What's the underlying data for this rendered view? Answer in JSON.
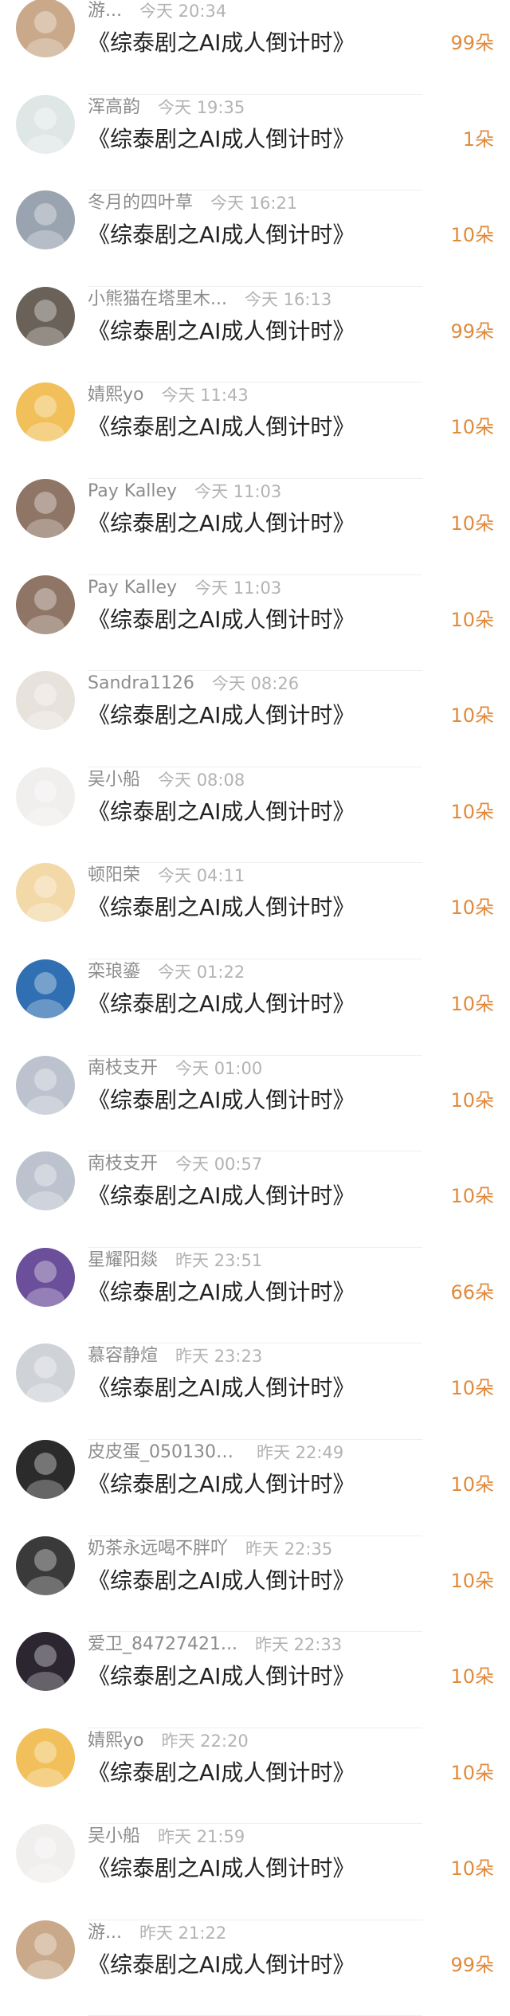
{
  "accent_color": "#e08a3c",
  "items": [
    {
      "name": "游...",
      "time": "今天 20:34",
      "title": "《综泰剧之AI成人倒计时》",
      "count": "99朵",
      "avatar": "girl-portrait-avatar",
      "avatar_color": "#c9a98a"
    },
    {
      "name": "浑高韵",
      "time": "今天 19:35",
      "title": "《综泰剧之AI成人倒计时》",
      "count": "1朵",
      "avatar": "anime-girl-avatar",
      "avatar_color": "#dfe6e6"
    },
    {
      "name": "冬月的四叶草",
      "time": "今天 16:21",
      "title": "《综泰剧之AI成人倒计时》",
      "count": "10朵",
      "avatar": "cat-avatar",
      "avatar_color": "#9aa4b0"
    },
    {
      "name": "小熊猫在塔里木...",
      "time": "今天 16:13",
      "title": "《综泰剧之AI成人倒计时》",
      "count": "99朵",
      "avatar": "child-photo-avatar",
      "avatar_color": "#6a6258"
    },
    {
      "name": "婧熙yo",
      "time": "今天 11:43",
      "title": "《综泰剧之AI成人倒计时》",
      "count": "10朵",
      "avatar": "cartoon-tiger-avatar",
      "avatar_color": "#f2c05a"
    },
    {
      "name": "Pay Kalley",
      "time": "今天 11:03",
      "title": "《综泰剧之AI成人倒计时》",
      "count": "10朵",
      "avatar": "woman-photo-avatar",
      "avatar_color": "#8e7565"
    },
    {
      "name": "Pay Kalley",
      "time": "今天 11:03",
      "title": "《综泰剧之AI成人倒计时》",
      "count": "10朵",
      "avatar": "woman-photo-avatar",
      "avatar_color": "#8e7565"
    },
    {
      "name": "Sandra1126",
      "time": "今天 08:26",
      "title": "《综泰剧之AI成人倒计时》",
      "count": "10朵",
      "avatar": "cartoon-boy-avatar",
      "avatar_color": "#e8e2dc"
    },
    {
      "name": "吴小船",
      "time": "今天 08:08",
      "title": "《综泰剧之AI成人倒计时》",
      "count": "10朵",
      "avatar": "cartoon-chibi-avatar",
      "avatar_color": "#f1eeee"
    },
    {
      "name": "顿阳荣",
      "time": "今天 04:11",
      "title": "《综泰剧之AI成人倒计时》",
      "count": "10朵",
      "avatar": "cartoon-bear-avatar",
      "avatar_color": "#f3d8a8"
    },
    {
      "name": "栾琅鎏",
      "time": "今天 01:22",
      "title": "《综泰剧之AI成人倒计时》",
      "count": "10朵",
      "avatar": "cartoon-sponge-avatar",
      "avatar_color": "#2f6fb2"
    },
    {
      "name": "南枝支开",
      "time": "今天 01:00",
      "title": "《综泰剧之AI成人倒计时》",
      "count": "10朵",
      "avatar": "man-portrait-avatar",
      "avatar_color": "#bcc3cf"
    },
    {
      "name": "南枝支开",
      "time": "今天 00:57",
      "title": "《综泰剧之AI成人倒计时》",
      "count": "10朵",
      "avatar": "man-portrait-avatar",
      "avatar_color": "#bcc3cf"
    },
    {
      "name": "星耀阳燚",
      "time": "昨天 23:51",
      "title": "《综泰剧之AI成人倒计时》",
      "count": "66朵",
      "avatar": "purple-portrait-avatar",
      "avatar_color": "#6b4f9a"
    },
    {
      "name": "慕容静煊",
      "time": "昨天 23:23",
      "title": "《综泰剧之AI成人倒计时》",
      "count": "10朵",
      "avatar": "girl-photo-avatar",
      "avatar_color": "#cfd3d8"
    },
    {
      "name": "皮皮蛋_0501303...",
      "time": "昨天 22:49",
      "title": "《综泰剧之AI成人倒计时》",
      "count": "10朵",
      "avatar": "dark-portrait-avatar",
      "avatar_color": "#2b2b2b"
    },
    {
      "name": "奶茶永远喝不胖吖",
      "time": "昨天 22:35",
      "title": "《综泰剧之AI成人倒计时》",
      "count": "10朵",
      "avatar": "black-cat-avatar",
      "avatar_color": "#3a3a3a"
    },
    {
      "name": "爱卫_84727421...",
      "time": "昨天 22:33",
      "title": "《综泰剧之AI成人倒计时》",
      "count": "10朵",
      "avatar": "boy-portrait-avatar",
      "avatar_color": "#2c2630"
    },
    {
      "name": "婧熙yo",
      "time": "昨天 22:20",
      "title": "《综泰剧之AI成人倒计时》",
      "count": "10朵",
      "avatar": "cartoon-tiger-avatar",
      "avatar_color": "#f2c05a"
    },
    {
      "name": "吴小船",
      "time": "昨天 21:59",
      "title": "《综泰剧之AI成人倒计时》",
      "count": "10朵",
      "avatar": "cartoon-chibi-avatar",
      "avatar_color": "#f1eeee"
    },
    {
      "name": "游...",
      "time": "昨天 21:22",
      "title": "《综泰剧之AI成人倒计时》",
      "count": "99朵",
      "avatar": "girl-portrait-avatar",
      "avatar_color": "#c9a98a"
    }
  ]
}
